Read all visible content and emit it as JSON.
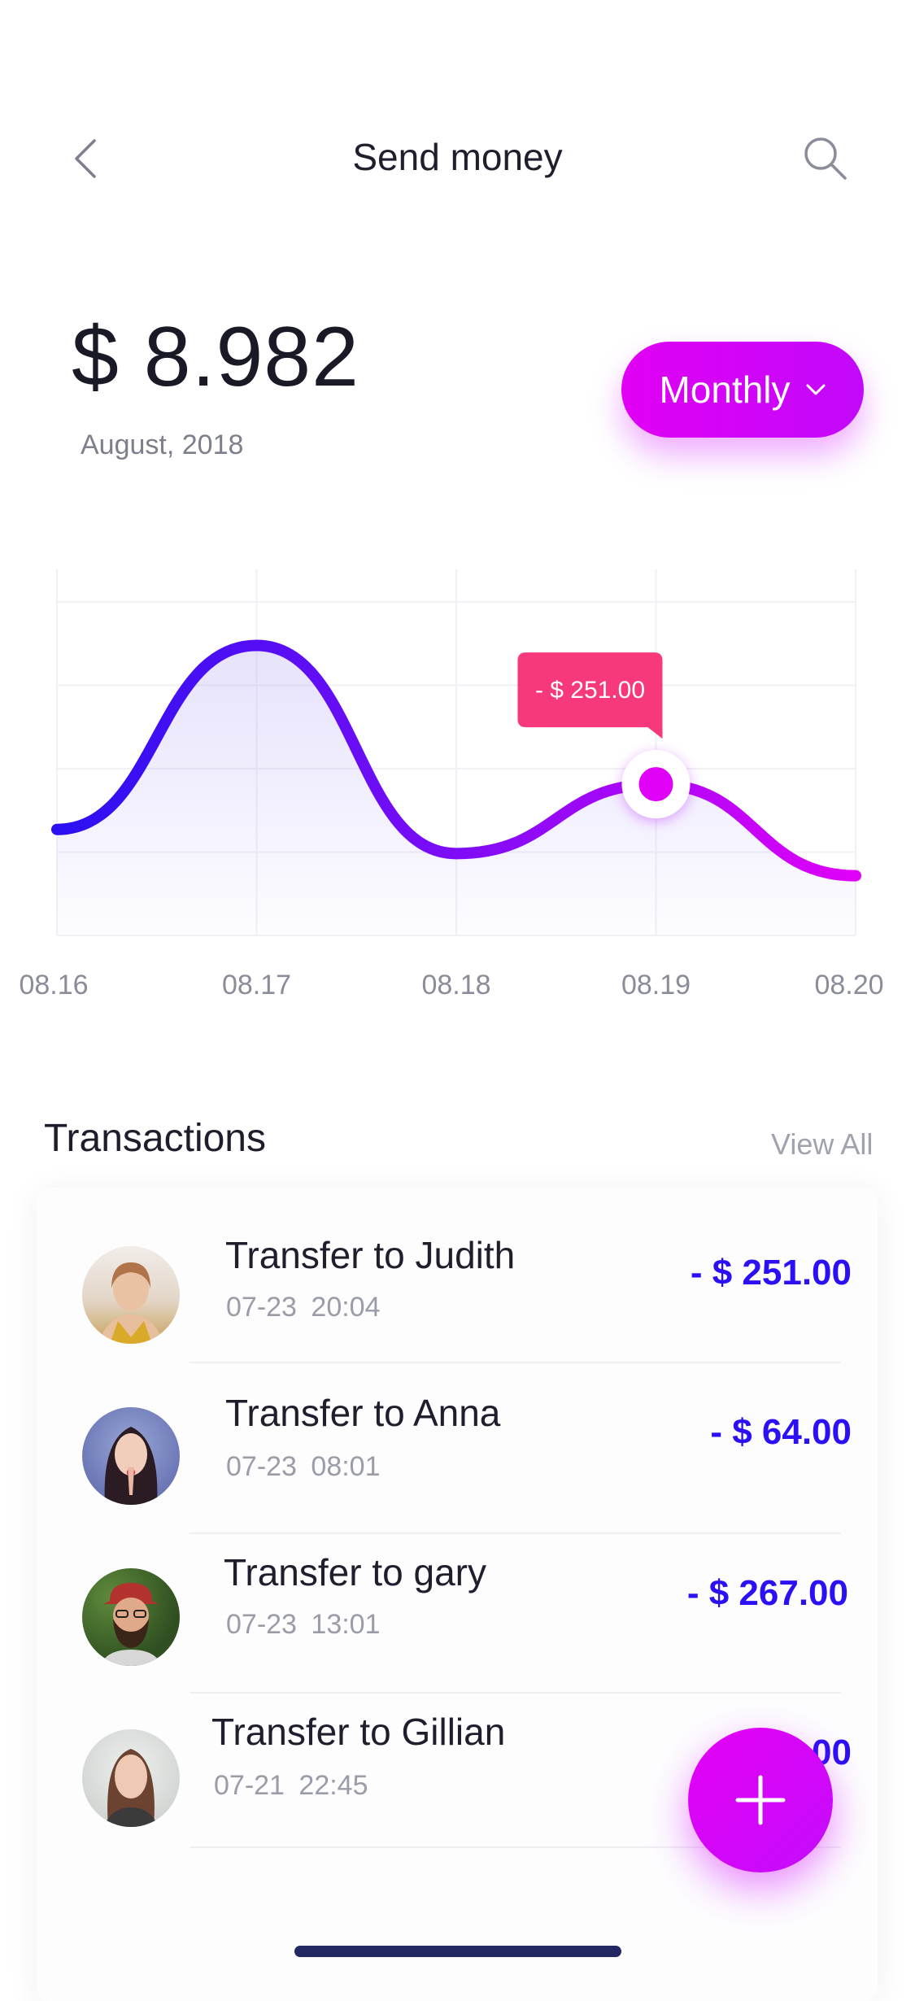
{
  "header": {
    "title": "Send money",
    "back_icon": "chevron-left-icon",
    "search_icon": "search-icon"
  },
  "balance": {
    "amount": "$ 8.982",
    "date": "August, 2018"
  },
  "period_selector": {
    "label": "Monthly",
    "icon": "chevron-down-icon",
    "color": "#d000f8"
  },
  "chart_data": {
    "type": "line",
    "x": [
      "08.16",
      "08.17",
      "08.18",
      "08.19",
      "08.20"
    ],
    "series": [
      {
        "points": [
          {
            "x": "08.16",
            "y": 50
          },
          {
            "x": "08.17",
            "y": 241
          },
          {
            "x": "08.18",
            "y": 25
          },
          {
            "x": "08.19",
            "y": 97
          },
          {
            "x": "08.20",
            "y": 2
          }
        ]
      }
    ],
    "highlight": {
      "x": "08.19",
      "label": "- $ 251.00"
    },
    "ylim": [
      -60,
      320
    ],
    "grid": true,
    "colors": {
      "start": "#2a10f2",
      "end": "#e000f8",
      "tooltip": "#f7387a"
    }
  },
  "transactions": {
    "title": "Transactions",
    "view_all": "View All",
    "items": [
      {
        "name": "Transfer to Judith",
        "date": "07-23",
        "time": "20:04",
        "amount": "- $ 251.00"
      },
      {
        "name": "Transfer to Anna",
        "date": "07-23",
        "time": "08:01",
        "amount": "- $ 64.00"
      },
      {
        "name": "Transfer to gary",
        "date": "07-23",
        "time": "13:01",
        "amount": "- $ 267.00"
      },
      {
        "name": "Transfer to Gillian",
        "date": "07-21",
        "time": "22:45",
        "amount": "- $ 88.00"
      }
    ]
  },
  "fab": {
    "icon": "plus-icon"
  }
}
